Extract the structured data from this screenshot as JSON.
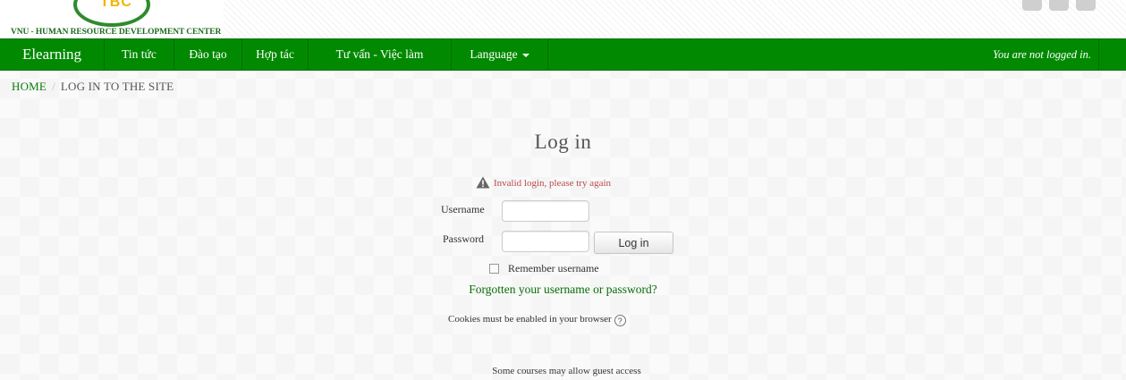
{
  "header": {
    "logo_text": "TBC",
    "subtitle": "VNU - HUMAN RESOURCE DEVELOPMENT CENTER"
  },
  "navbar": {
    "brand": "Elearning",
    "items": [
      "Tin tức",
      "Đào tạo",
      "Hợp tác",
      "Tư vấn - Việc làm"
    ],
    "language_label": "Language",
    "login_status": "You are not logged in."
  },
  "breadcrumb": {
    "home": "HOME",
    "separator": "/",
    "current": "LOG IN TO THE SITE"
  },
  "login": {
    "title": "Log in",
    "error": "Invalid login, please try again",
    "username_label": "Username",
    "username_value": "",
    "password_label": "Password",
    "password_value": "",
    "submit_label": "Log in",
    "remember_label": "Remember username",
    "remember_checked": false,
    "forgot_link": "Forgotten your username or password?",
    "cookies_notice": "Cookies must be enabled in your browser",
    "help_glyph": "?",
    "guest_notice": "Some courses may allow guest access"
  },
  "colors": {
    "nav_green": "#018a01",
    "link_green": "#0a7a0a",
    "error_red": "#b94a48",
    "logo_gold": "#f0b400"
  }
}
